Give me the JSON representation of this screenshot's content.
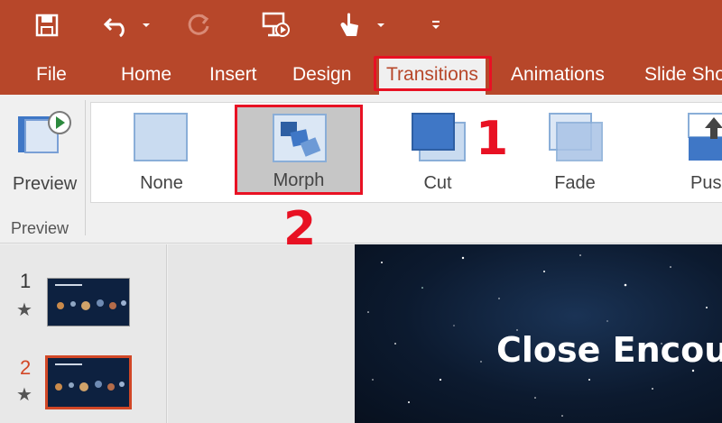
{
  "quick_access": {
    "icons": [
      "save-icon",
      "undo-icon",
      "undo-dropdown-icon",
      "redo-icon",
      "present-from-start-icon",
      "touch-mode-icon",
      "touch-dropdown-icon",
      "customize-qat-icon"
    ]
  },
  "tabs": [
    {
      "label": "File"
    },
    {
      "label": "Home"
    },
    {
      "label": "Insert"
    },
    {
      "label": "Design"
    },
    {
      "label": "Transitions",
      "active": true
    },
    {
      "label": "Animations"
    },
    {
      "label": "Slide Sho"
    }
  ],
  "ribbon": {
    "preview_label": "Preview",
    "group_label": "Preview",
    "transitions": [
      {
        "label": "None"
      },
      {
        "label": "Morph",
        "selected": true
      },
      {
        "label": "Cut"
      },
      {
        "label": "Fade"
      },
      {
        "label": "Pus"
      }
    ]
  },
  "annotations": {
    "step1": "1",
    "step2": "2"
  },
  "slides": [
    {
      "number": "1",
      "has_animation_star": true
    },
    {
      "number": "2",
      "has_animation_star": true,
      "selected": true
    }
  ],
  "current_slide": {
    "title": "Close Encount"
  },
  "colors": {
    "accent": "#b7472a",
    "annotation_red": "#e81123",
    "slide_bg": "#0c1a2f"
  }
}
